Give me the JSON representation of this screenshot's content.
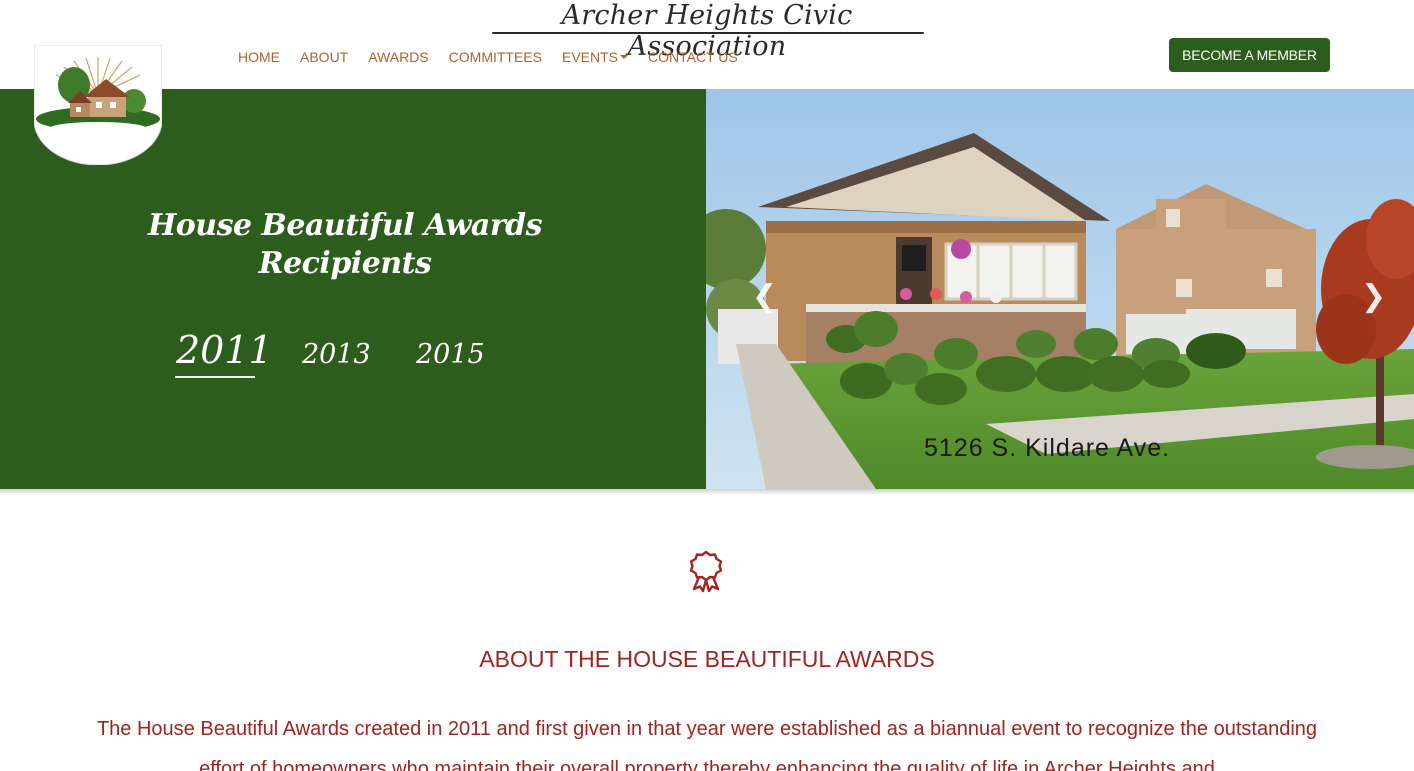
{
  "header": {
    "site_title": "Archer Heights Civic Association",
    "nav": [
      {
        "label": "HOME"
      },
      {
        "label": "ABOUT"
      },
      {
        "label": "AWARDS"
      },
      {
        "label": "COMMITTEES"
      },
      {
        "label": "EVENTS",
        "dropdown": true
      },
      {
        "label": "CONTACT US"
      }
    ],
    "member_button": "BECOME A MEMBER"
  },
  "hero": {
    "title_line1": "House Beautiful Awards",
    "title_line2": "Recipients",
    "years": [
      "2011",
      "2013",
      "2015"
    ],
    "active_year": "2011",
    "slide_caption": "5126 S. Kildare Ave.",
    "prev_icon": "chevron-left-icon",
    "next_icon": "chevron-right-icon"
  },
  "about": {
    "icon": "award-ribbon-icon",
    "title": "ABOUT THE HOUSE BEAUTIFUL AWARDS",
    "body": "The House Beautiful Awards created in 2011 and first given in that year were established as a biannual event to recognize the outstanding effort of homeowners who maintain their overall property thereby enhancing the quality of life in Archer Heights and"
  },
  "colors": {
    "brand_green": "#2d5d1c",
    "nav_orange": "#b5602a",
    "accent_red": "#a0241f"
  }
}
